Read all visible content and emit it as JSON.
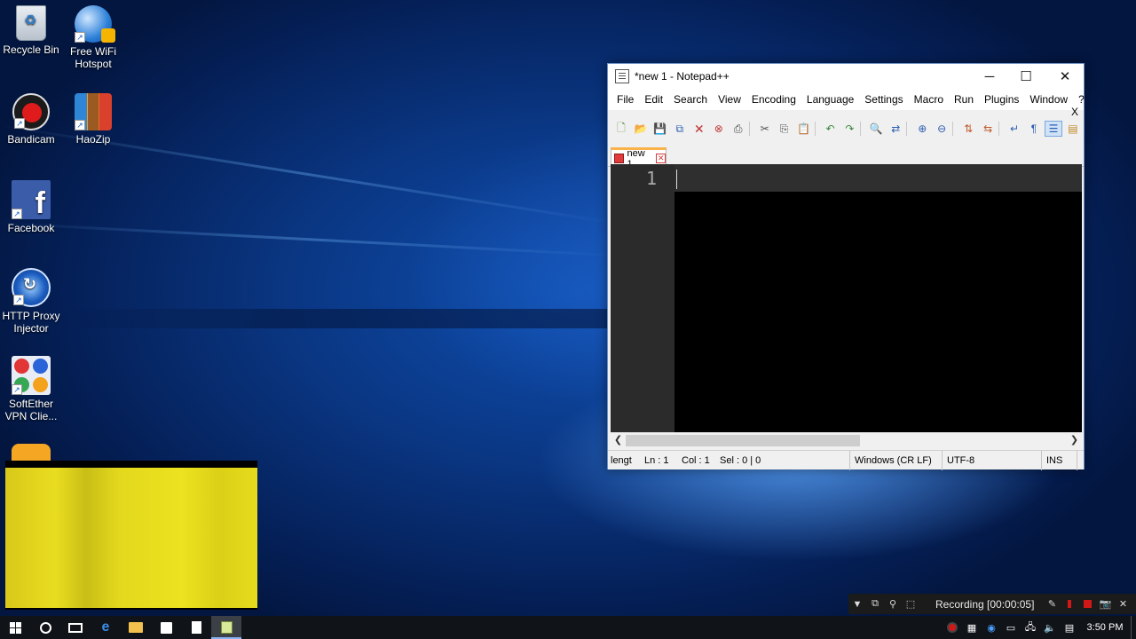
{
  "desktop": {
    "icons": [
      {
        "label": "Recycle Bin",
        "icon": "recycle-bin-icon"
      },
      {
        "label": "Free WiFi Hotspot",
        "icon": "globe-wifi-icon"
      },
      {
        "label": "Bandicam",
        "icon": "bandicam-icon"
      },
      {
        "label": "HaoZip",
        "icon": "haozip-icon"
      },
      {
        "label": "Facebook",
        "icon": "facebook-icon"
      },
      {
        "label": "HTTP Proxy Injector",
        "icon": "proxy-injector-icon"
      },
      {
        "label": "SoftEther VPN Clie...",
        "icon": "softether-icon"
      }
    ]
  },
  "window": {
    "title": "*new 1 - Notepad++",
    "controls": {
      "minimize": "─",
      "maximize": "☐",
      "close": "✕"
    },
    "menu": [
      "File",
      "Edit",
      "Search",
      "View",
      "Encoding",
      "Language",
      "Settings",
      "Macro",
      "Run",
      "Plugins",
      "Window",
      "?"
    ],
    "menu_close": "X",
    "tab": {
      "label": "new 1"
    },
    "editor": {
      "line_number": "1"
    },
    "status": {
      "length": "lengt",
      "ln": "Ln : 1",
      "col": "Col : 1",
      "sel": "Sel : 0 | 0",
      "eol": "Windows (CR LF)",
      "encoding": "UTF-8",
      "mode": "INS"
    }
  },
  "recording": {
    "text": "Recording [00:00:05]"
  },
  "taskbar": {
    "clock": "3:50 PM",
    "accent": "#8ab4f8"
  }
}
